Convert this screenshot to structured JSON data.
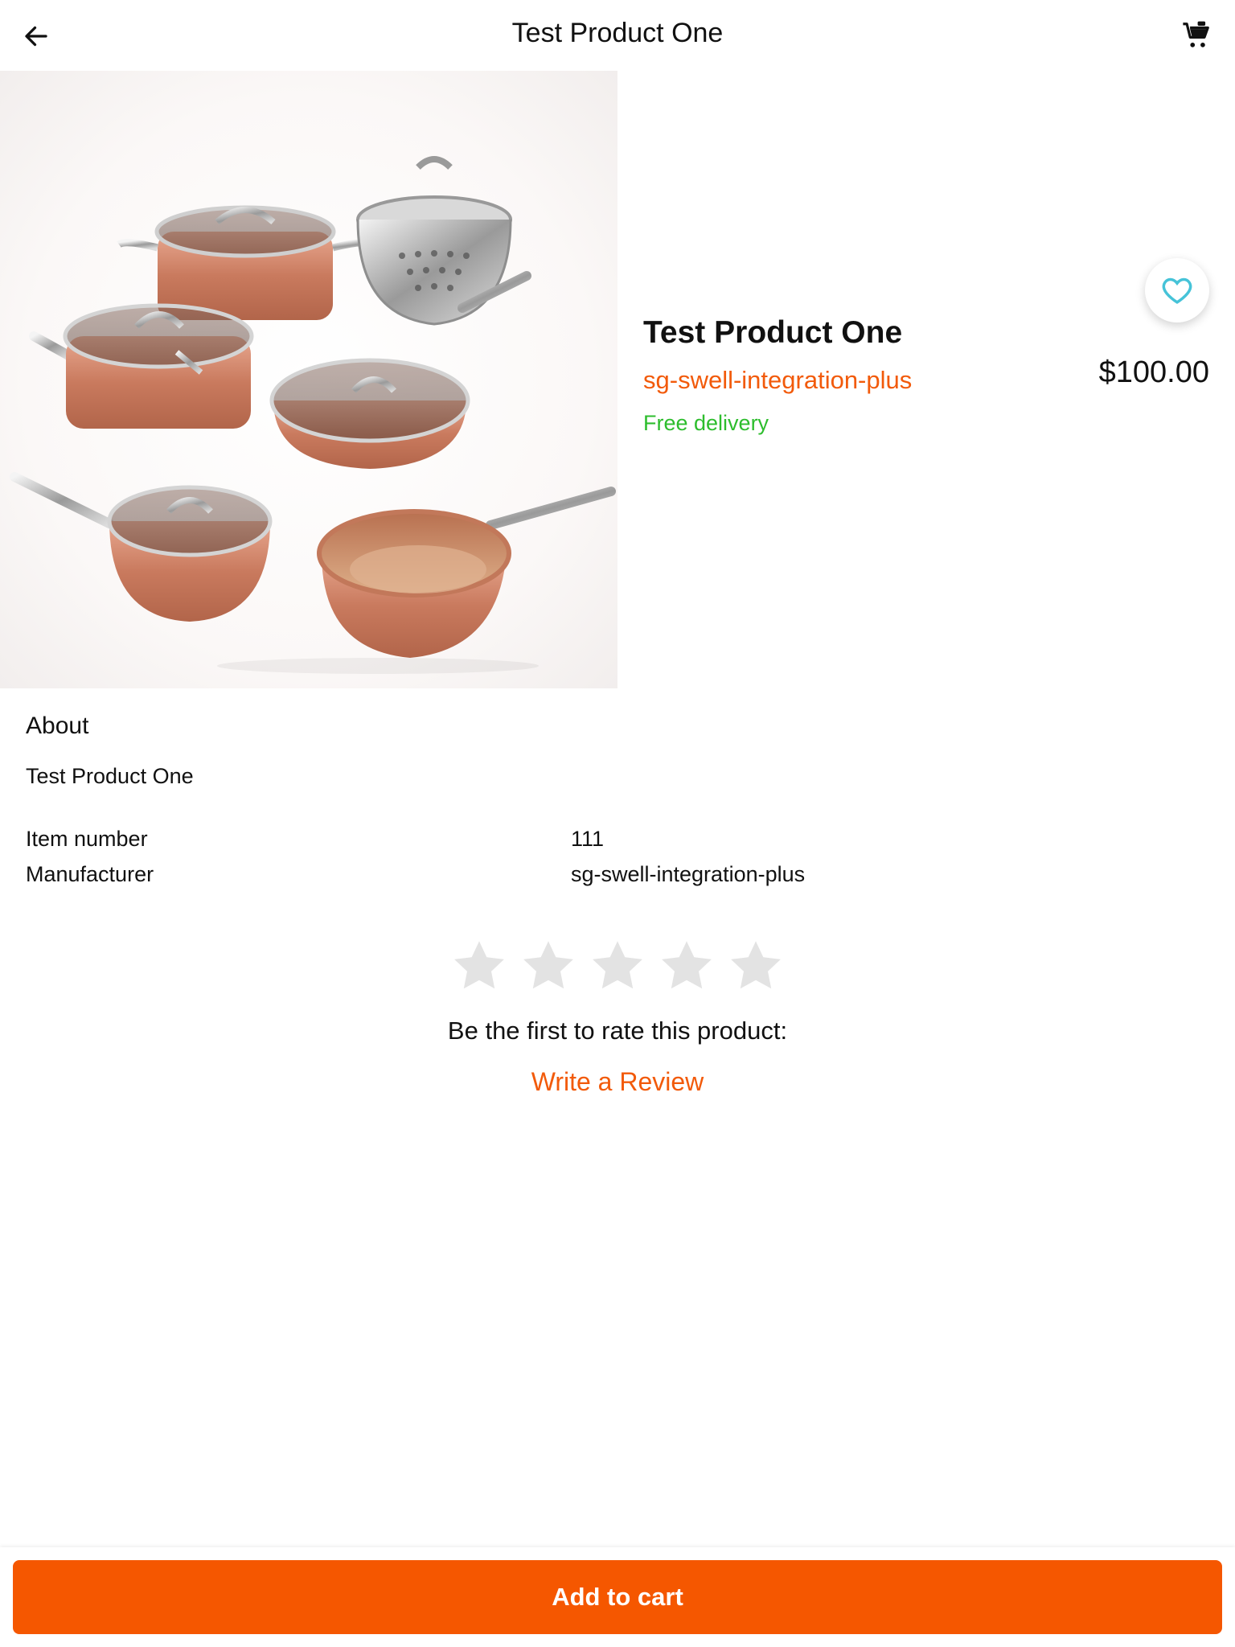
{
  "header": {
    "title": "Test Product One",
    "back_icon": "arrow-left-icon",
    "cart_icon": "shopping-cart-icon"
  },
  "product": {
    "name": "Test Product One",
    "vendor": "sg-swell-integration-plus",
    "delivery": "Free delivery",
    "price": "$100.00",
    "favorite_icon": "heart-outline-icon"
  },
  "about": {
    "title": "About",
    "description": "Test Product One",
    "specs": [
      {
        "label": "Item number",
        "value": "111"
      },
      {
        "label": "Manufacturer",
        "value": "sg-swell-integration-plus"
      }
    ]
  },
  "rating": {
    "max_stars": 5,
    "filled_stars": 0,
    "prompt": "Be the first to rate this product:",
    "write_review": "Write a Review"
  },
  "actions": {
    "add_to_cart": "Add to cart"
  },
  "colors": {
    "accent": "#f25a0a",
    "button": "#f55700",
    "delivery": "#2dbd2d",
    "heart": "#46c3d8",
    "star_empty": "#e3e3e3"
  }
}
